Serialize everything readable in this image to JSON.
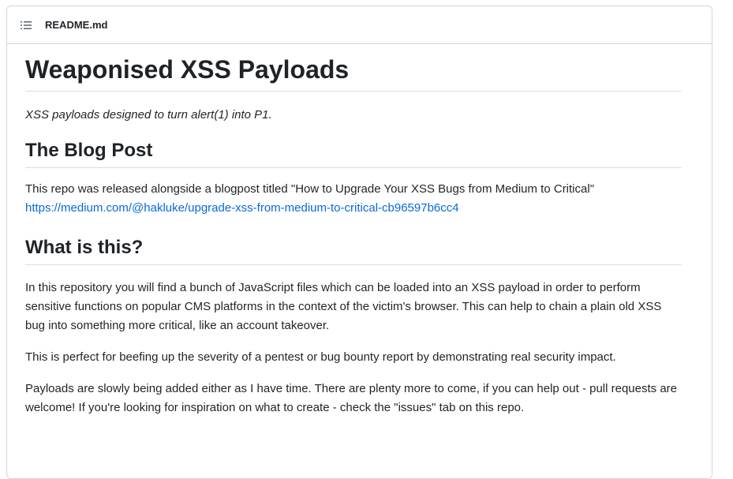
{
  "header": {
    "file_name": "README.md",
    "icon": "list-unordered-icon"
  },
  "readme": {
    "title": "Weaponised XSS Payloads",
    "tagline": "XSS payloads designed to turn alert(1) into P1.",
    "section_blog": {
      "heading": "The Blog Post",
      "text": "This repo was released alongside a blogpost titled \"How to Upgrade Your XSS Bugs from Medium to Critical\"",
      "link": "https://medium.com/@hakluke/upgrade-xss-from-medium-to-critical-cb96597b6cc4"
    },
    "section_what": {
      "heading": "What is this?",
      "p1": "In this repository you will find a bunch of JavaScript files which can be loaded into an XSS payload in order to perform sensitive functions on popular CMS platforms in the context of the victim's browser. This can help to chain a plain old XSS bug into something more critical, like an account takeover.",
      "p2": "This is perfect for beefing up the severity of a pentest or bug bounty report by demonstrating real security impact.",
      "p3": "Payloads are slowly being added either as I have time. There are plenty more to come, if you can help out - pull requests are welcome! If you're looking for inspiration on what to create - check the \"issues\" tab on this repo."
    }
  },
  "colors": {
    "link": "#0969da",
    "border": "#d0d7de",
    "text": "#1f2328"
  }
}
